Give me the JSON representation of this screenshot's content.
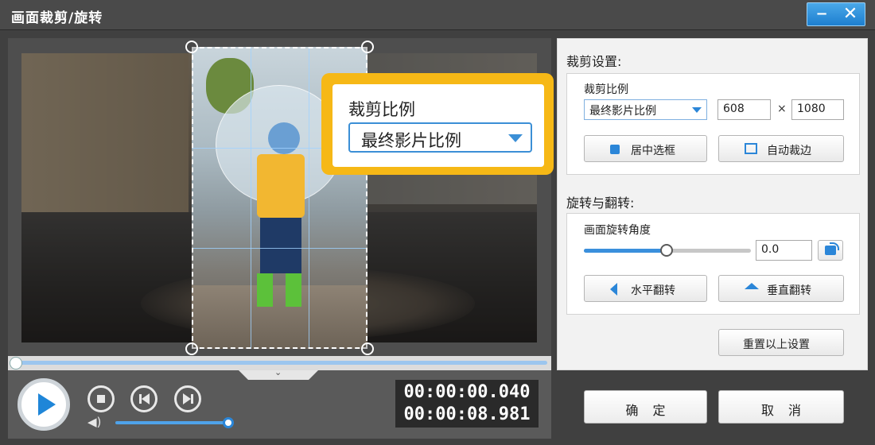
{
  "window": {
    "title": "画面裁剪/旋转",
    "minimize_glyph": "−",
    "close_glyph": "✕"
  },
  "callout": {
    "label": "裁剪比例",
    "selected": "最终影片比例"
  },
  "player": {
    "time_current": "00:00:00.040",
    "time_total": "00:00:08.981",
    "collapse_glyph": "⌄",
    "volume_glyph": "◀)",
    "progress": 0.0,
    "volume": 0.95
  },
  "crop": {
    "section_title": "裁剪设置:",
    "ratio_label": "裁剪比例",
    "ratio_selected": "最终影片比例",
    "width_value": "608",
    "times_glyph": "×",
    "height_value": "1080",
    "center_button": "居中选框",
    "auto_button": "自动裁边"
  },
  "rotate": {
    "section_title": "旋转与翻转:",
    "angle_label": "画面旋转角度",
    "angle_value": "0.0",
    "angle_slider": 0.5,
    "flip_h_button": "水平翻转",
    "flip_v_button": "垂直翻转",
    "reset_button": "重置以上设置"
  },
  "footer": {
    "ok_button": "确定",
    "cancel_button": "取消"
  },
  "colors": {
    "accent": "#2b86d8",
    "callout": "#f6b816"
  }
}
